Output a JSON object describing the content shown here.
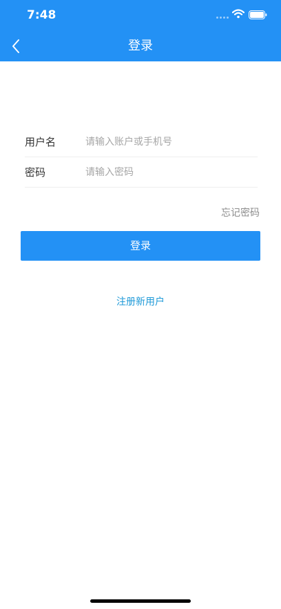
{
  "status_bar": {
    "time": "7:48"
  },
  "nav": {
    "title": "登录",
    "back_icon": "chevron-left-icon"
  },
  "form": {
    "username": {
      "label": "用户名",
      "placeholder": "请输入账户或手机号",
      "value": ""
    },
    "password": {
      "label": "密码",
      "placeholder": "请输入密码",
      "value": ""
    },
    "forgot_password": "忘记密码",
    "login_button": "登录",
    "register_link": "注册新用户"
  },
  "colors": {
    "accent": "#2391f5",
    "link": "#1f9ad8"
  }
}
